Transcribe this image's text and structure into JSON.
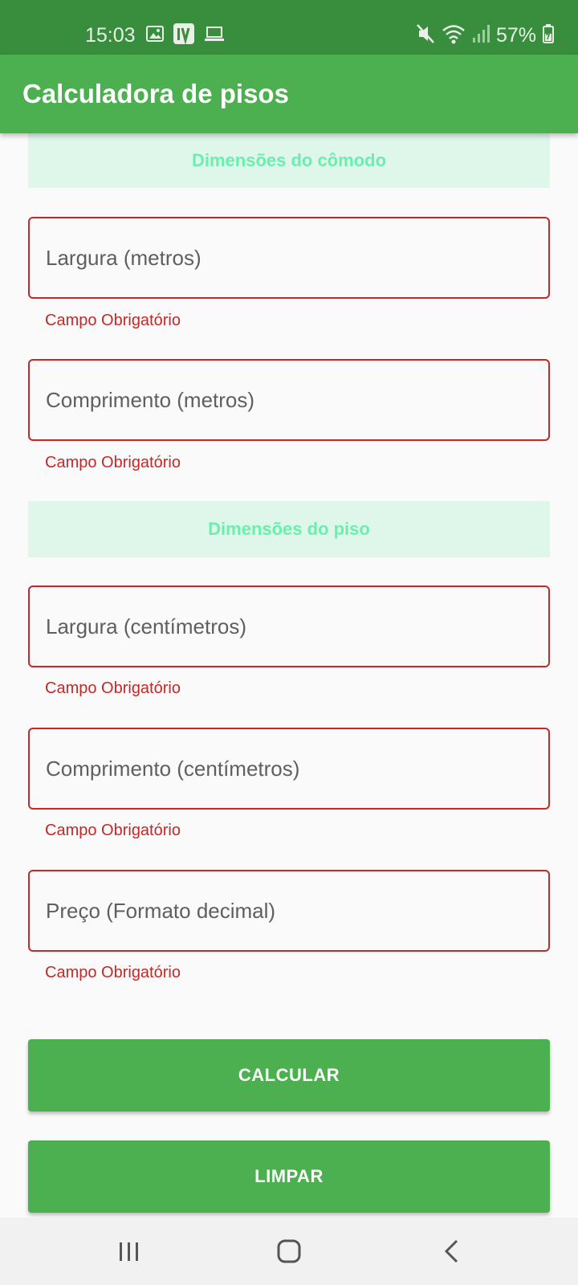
{
  "status_bar": {
    "time": "15:03",
    "battery": "57%",
    "icons": [
      "image-icon",
      "iv-app-icon",
      "laptop-icon",
      "mute-icon",
      "wifi-icon",
      "signal-icon",
      "battery-icon"
    ]
  },
  "app_bar": {
    "title": "Calculadora de pisos"
  },
  "sections": {
    "room": {
      "title": "Dimensões do cômodo"
    },
    "tile": {
      "title": "Dimensões do piso"
    }
  },
  "fields": [
    {
      "placeholder": "Largura (metros)",
      "value": "",
      "error": "Campo Obrigatório"
    },
    {
      "placeholder": "Comprimento (metros)",
      "value": "",
      "error": "Campo Obrigatório"
    },
    {
      "placeholder": "Largura (centímetros)",
      "value": "",
      "error": "Campo Obrigatório"
    },
    {
      "placeholder": "Comprimento (centímetros)",
      "value": "",
      "error": "Campo Obrigatório"
    },
    {
      "placeholder": "Preço (Formato decimal)",
      "value": "",
      "error": "Campo Obrigatório"
    }
  ],
  "buttons": {
    "calculate": "CALCULAR",
    "clear": "LIMPAR"
  },
  "nav_bar": {
    "icons": [
      "recent-apps-icon",
      "home-icon",
      "back-icon"
    ]
  },
  "colors": {
    "primary": "#4caf50",
    "primary_dark": "#388e3c",
    "section_bg": "#dff6ea",
    "section_text": "#69f0ae",
    "error": "#c62828"
  }
}
